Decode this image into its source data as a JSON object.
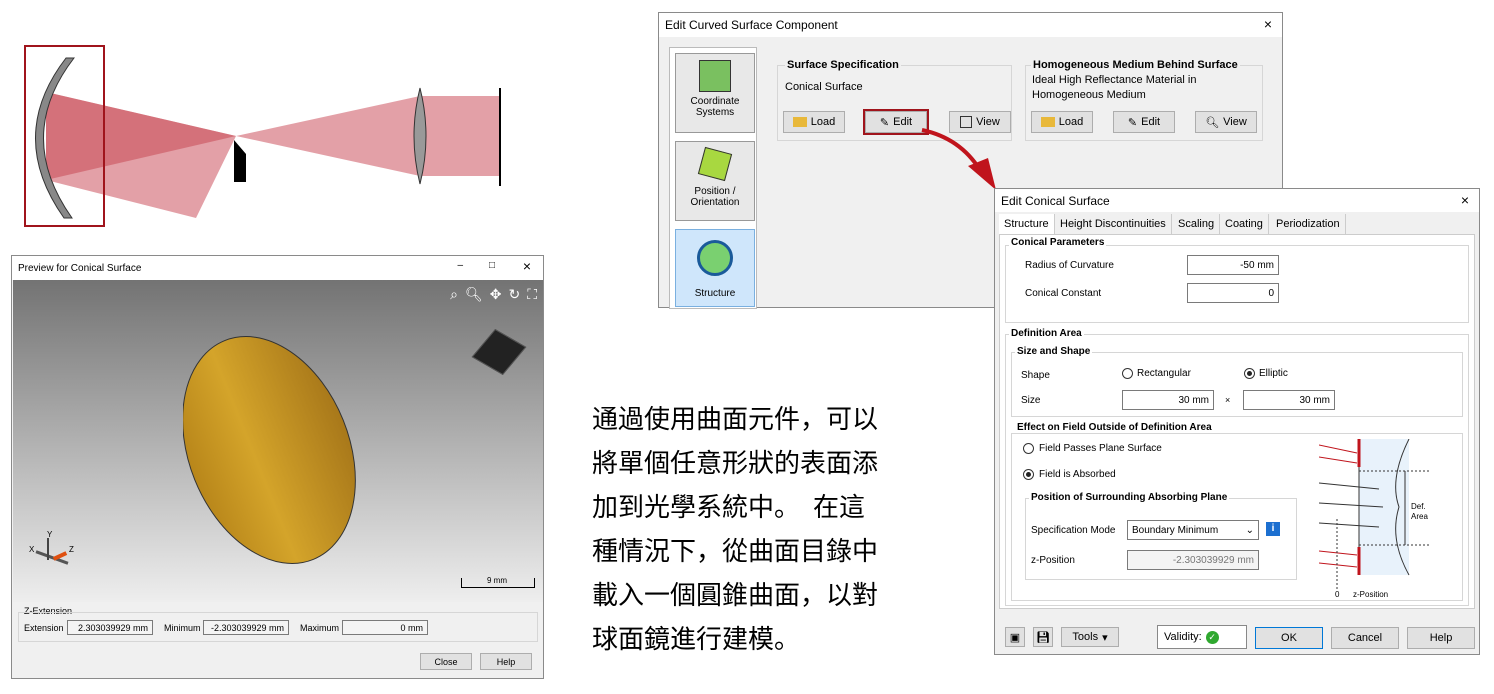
{
  "edit_curved": {
    "title": "Edit Curved Surface Component",
    "close": "×",
    "side": {
      "coord": "Coordinate\nSystems",
      "coord1": "Coordinate",
      "coord2": "Systems",
      "pos1": "Position /",
      "pos2": "Orientation",
      "structure": "Structure"
    },
    "surface_spec": {
      "header": "Surface Specification",
      "value": "Conical Surface",
      "load": "Load",
      "edit": "Edit",
      "view": "View"
    },
    "medium": {
      "header": "Homogeneous Medium Behind Surface",
      "line1": "Ideal High Reflectance Material in",
      "line2": "Homogeneous Medium",
      "load": "Load",
      "edit": "Edit",
      "view": "View"
    }
  },
  "edit_conical": {
    "title": "Edit Conical Surface",
    "close": "×",
    "tabs": [
      "Structure",
      "Height Discontinuities",
      "Scaling",
      "Coating",
      "Periodization"
    ],
    "conical_params": "Conical Parameters",
    "radius_label": "Radius of Curvature",
    "radius_value": "-50 mm",
    "constant_label": "Conical Constant",
    "constant_value": "0",
    "definition_area": "Definition Area",
    "size_shape": "Size and Shape",
    "shape_label": "Shape",
    "rectangular": "Rectangular",
    "elliptic": "Elliptic",
    "size_label": "Size",
    "size_x": "30 mm",
    "times": "×",
    "size_y": "30 mm",
    "effect": "Effect on Field Outside of Definition Area",
    "passes": "Field Passes Plane Surface",
    "absorbed": "Field is Absorbed",
    "position_plane": "Position of Surrounding Absorbing Plane",
    "spec_mode_label": "Specification Mode",
    "spec_mode_value": "Boundary Minimum",
    "zpos_label": "z-Position",
    "zpos_value": "-2.303039929 mm",
    "diagram": {
      "def": "Def.",
      "area": "Area",
      "zero": "0",
      "zpos": "z-Position"
    },
    "tools": "Tools",
    "validity": "Validity:",
    "ok": "OK",
    "cancel": "Cancel",
    "help": "Help"
  },
  "preview": {
    "title": "Preview for Conical Surface",
    "min": "–",
    "max": "□",
    "close": "×",
    "scale": "9 mm",
    "axes": {
      "x": "X",
      "y": "Y",
      "z": "Z"
    },
    "zext": "Z-Extension",
    "ext_label": "Extension",
    "ext_value": "2.303039929 mm",
    "min_label": "Minimum",
    "min_value": "-2.303039929 mm",
    "max_label": "Maximum",
    "max_value": "0 mm",
    "close_btn": "Close",
    "help_btn": "Help"
  },
  "caption": [
    "通過使用曲面元件，可以",
    "將單個任意形狀的表面添",
    "加到光學系統中。　在這",
    "種情況下，從曲面目錄中",
    "載入一個圓錐曲面，以對",
    "球面鏡進行建模。"
  ],
  "colors": {
    "accent_red": "#c0141c",
    "beam": "#d9808a",
    "ellipse": "#c8981e"
  }
}
